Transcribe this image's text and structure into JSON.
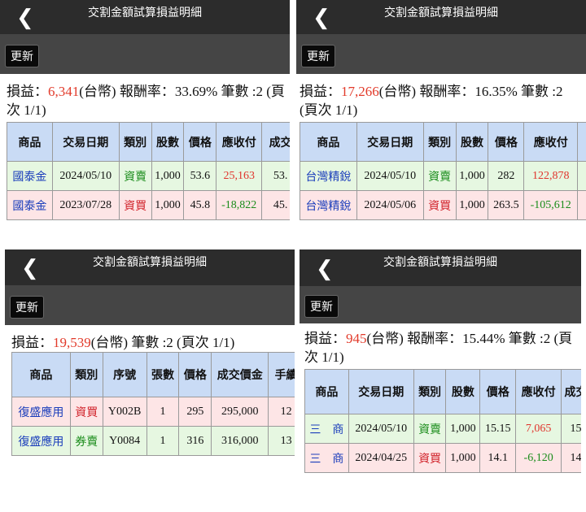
{
  "common": {
    "back_glyph": "❮",
    "title": "交割金額試算損益明細",
    "refresh_label": "更新"
  },
  "p1": {
    "summary": {
      "prefix": "損益：",
      "profit": "6,341",
      "rest": "(台幣) 報酬率：33.69% 筆數 :2 (頁次 1/1)"
    },
    "headers": [
      "商品",
      "交易日期",
      "類別",
      "股數",
      "價格",
      "應收付",
      "成交"
    ],
    "rows": [
      {
        "cells": [
          "國泰金",
          "2024/05/10",
          "資賣",
          "1,000",
          "53.6",
          "25,163",
          "53."
        ]
      },
      {
        "cells": [
          "國泰金",
          "2023/07/28",
          "資買",
          "1,000",
          "45.8",
          "-18,822",
          "45."
        ]
      }
    ]
  },
  "p2": {
    "summary": {
      "prefix": "損益：",
      "profit": "17,266",
      "rest": "(台幣) 報酬率：16.35% 筆數 :2 (頁次 1/1)"
    },
    "headers": [
      "商品",
      "交易日期",
      "類別",
      "股數",
      "價格",
      "應收付",
      ""
    ],
    "rows": [
      {
        "cells": [
          "台灣精銳",
          "2024/05/10",
          "資賣",
          "1,000",
          "282",
          "122,878",
          ""
        ]
      },
      {
        "cells": [
          "台灣精銳",
          "2024/05/06",
          "資買",
          "1,000",
          "263.5",
          "-105,612",
          ""
        ]
      }
    ]
  },
  "p3": {
    "summary": {
      "prefix": "損益：",
      "profit": "19,539",
      "rest": "(台幣) 筆數 :2 (頁次 1/1)"
    },
    "headers": [
      "商品",
      "類別",
      "序號",
      "張數",
      "價格",
      "成交價金",
      "手續"
    ],
    "rows": [
      {
        "cells": [
          "復盛應用",
          "資買",
          "Y002B",
          "1",
          "295",
          "295,000",
          "12"
        ]
      },
      {
        "cells": [
          "復盛應用",
          "券賣",
          "Y0084",
          "1",
          "316",
          "316,000",
          "13"
        ]
      }
    ]
  },
  "p4": {
    "summary": {
      "prefix": "損益：",
      "profit": "945",
      "rest": "(台幣) 報酬率：15.44% 筆數 :2 (頁次 1/1)"
    },
    "headers": [
      "商品",
      "交易日期",
      "類別",
      "股數",
      "價格",
      "應收付",
      "成交"
    ],
    "rows": [
      {
        "cells": [
          "三　商",
          "2024/05/10",
          "資賣",
          "1,000",
          "15.15",
          "7,065",
          "15"
        ]
      },
      {
        "cells": [
          "三　商",
          "2024/04/25",
          "資買",
          "1,000",
          "14.1",
          "-6,120",
          "14"
        ]
      }
    ]
  }
}
